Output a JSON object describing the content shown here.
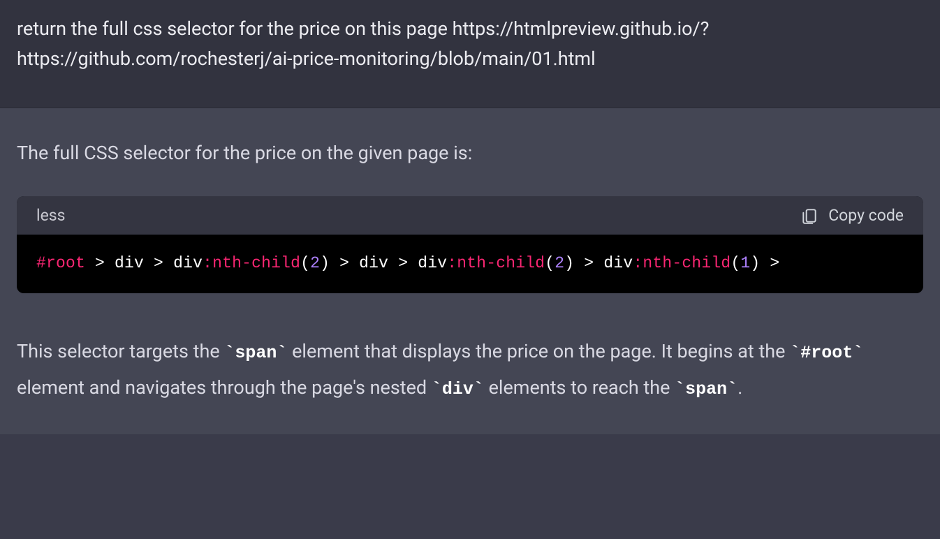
{
  "user_message": {
    "text": "return the full css selector for the price on this page https://htmlpreview.github.io/?https://github.com/rochesterj/ai-price-monitoring/blob/main/01.html"
  },
  "assistant_message": {
    "intro": "The full CSS selector for the price on the given page is:",
    "code_block": {
      "language": "less",
      "copy_label": "Copy code",
      "tokens": {
        "t0": "#root",
        "t1": " > ",
        "t2": "div",
        "t3": " > ",
        "t4": "div",
        "t5": ":nth-child",
        "t6": "(",
        "t7": "2",
        "t8": ")",
        "t9": " > ",
        "t10": "div",
        "t11": " > ",
        "t12": "div",
        "t13": ":nth-child",
        "t14": "(",
        "t15": "2",
        "t16": ")",
        "t17": " > ",
        "t18": "div",
        "t19": ":nth-child",
        "t20": "(",
        "t21": "1",
        "t22": ")",
        "t23": " >"
      }
    },
    "explain": {
      "pre1": "This selector targets the ",
      "code1_open": "`",
      "code1": "span",
      "code1_close": "`",
      "mid1": " element that displays the price on the page. It begins at the ",
      "code2_open": "`",
      "code2": "#root",
      "code2_close": "`",
      "mid2": " element and navigates through the page's nested ",
      "code3_open": "`",
      "code3": "div",
      "code3_close": "`",
      "mid3": " elements to reach the ",
      "code4_open": "`",
      "code4": "span",
      "code4_close": "`",
      "post": "."
    }
  }
}
